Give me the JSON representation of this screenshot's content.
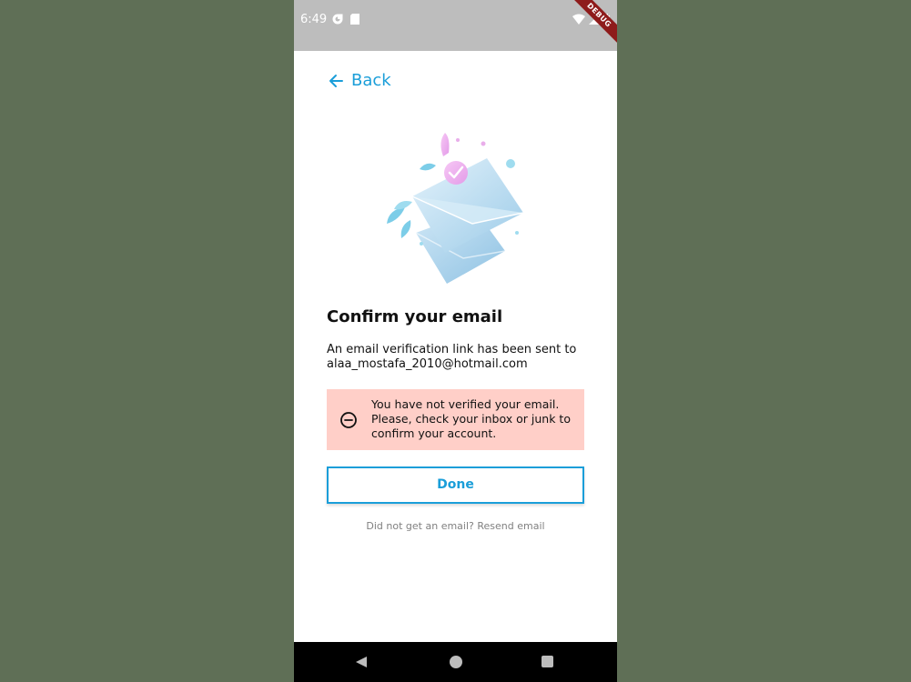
{
  "status_bar": {
    "time": "6:49",
    "debug_label": "DEBUG"
  },
  "header": {
    "back_label": "Back"
  },
  "content": {
    "title": "Confirm your email",
    "description_line1": "An email verification link has been sent to",
    "email": "alaa_mostafa_2010@hotmail.com",
    "alert_text": "You have not verified your email. Please, check your inbox or junk to confirm your account.",
    "done_label": "Done",
    "resend_text": "Did not get an email? Resend email"
  },
  "colors": {
    "accent": "#1a9ed9",
    "alert_bg": "#ffcfc8",
    "status_bar_bg": "#bdbdbd",
    "page_bg": "#5f6f56"
  },
  "icons": {
    "back": "arrow-left-icon",
    "alert": "minus-circle-icon"
  }
}
